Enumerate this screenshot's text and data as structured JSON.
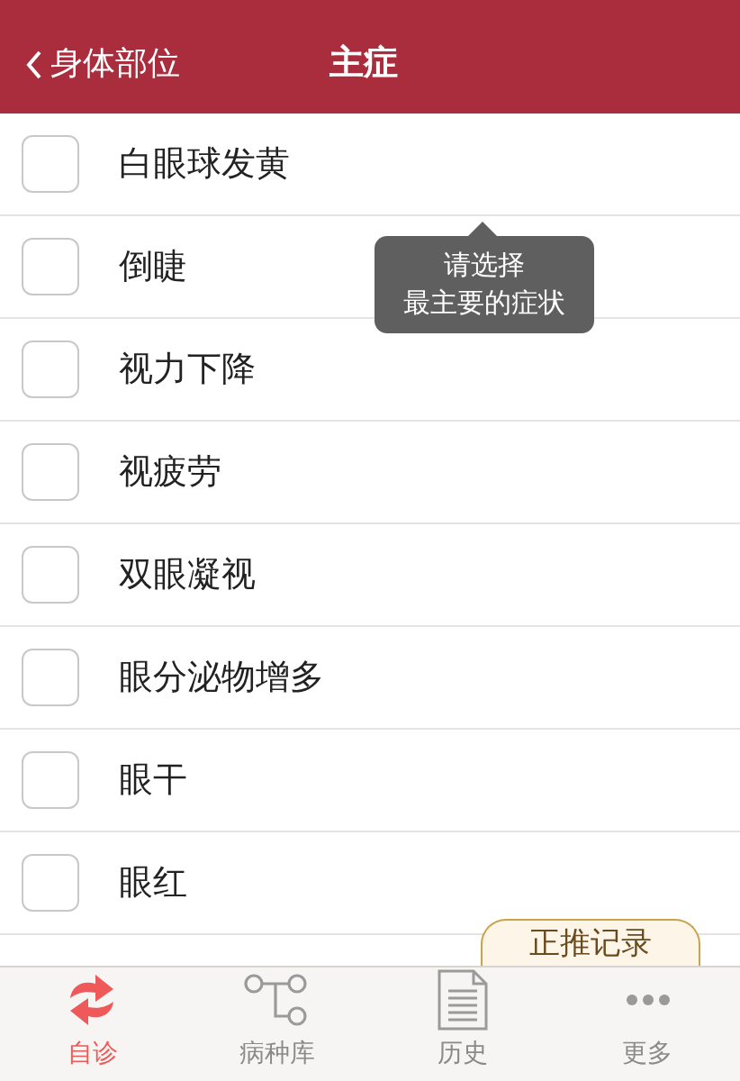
{
  "nav": {
    "back_label": "身体部位",
    "title": "主症"
  },
  "symptoms": [
    {
      "label": "白眼球发黄",
      "checked": false
    },
    {
      "label": "倒睫",
      "checked": false
    },
    {
      "label": "视力下降",
      "checked": false
    },
    {
      "label": "视疲劳",
      "checked": false
    },
    {
      "label": "双眼凝视",
      "checked": false
    },
    {
      "label": "眼分泌物增多",
      "checked": false
    },
    {
      "label": "眼干",
      "checked": false
    },
    {
      "label": "眼红",
      "checked": false
    }
  ],
  "tooltip": {
    "lines": [
      "请选择",
      "最主要的症状"
    ]
  },
  "record_tab": {
    "label": "正推记录"
  },
  "tab_bar": [
    {
      "label": "自诊",
      "kind": "refresh",
      "selected": true
    },
    {
      "label": "病种库",
      "kind": "tree",
      "selected": false
    },
    {
      "label": "历史",
      "kind": "document",
      "selected": false
    },
    {
      "label": "更多",
      "kind": "more",
      "selected": false
    }
  ]
}
